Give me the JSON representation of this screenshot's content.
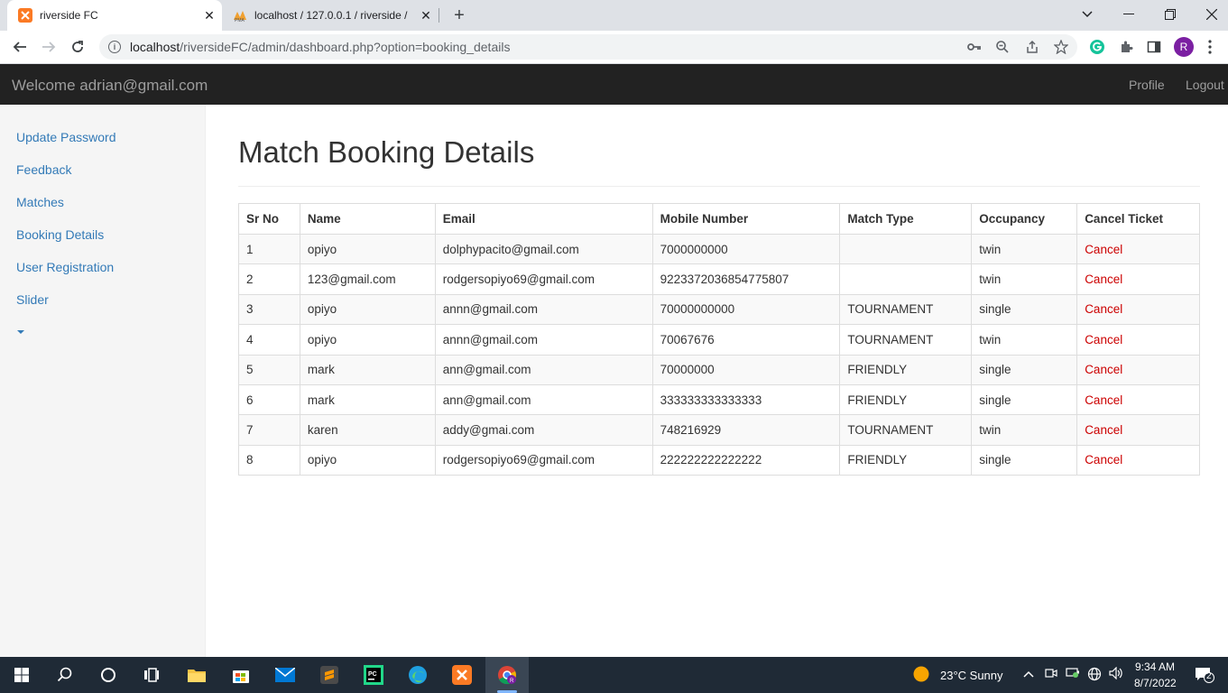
{
  "browser": {
    "tabs": [
      {
        "title": "riverside FC",
        "active": true
      },
      {
        "title": "localhost / 127.0.0.1 / riverside / ",
        "active": false
      }
    ],
    "url_host": "localhost",
    "url_path": "/riversideFC/admin/dashboard.php?option=booking_details",
    "profile_initial": "R"
  },
  "header": {
    "brand": "Welcome adrian@gmail.com",
    "links": [
      "Profile",
      "Logout"
    ]
  },
  "sidebar": {
    "items": [
      {
        "label": "Update Password"
      },
      {
        "label": "Feedback"
      },
      {
        "label": "Matches"
      },
      {
        "label": "Booking Details"
      },
      {
        "label": "User Registration"
      },
      {
        "label": "Slider"
      }
    ]
  },
  "main": {
    "title": "Match Booking Details",
    "table": {
      "headers": [
        "Sr No",
        "Name",
        "Email",
        "Mobile Number",
        "Match Type",
        "Occupancy",
        "Cancel Ticket"
      ],
      "rows": [
        [
          "1",
          "opiyo",
          "dolphypacito@gmail.com",
          "7000000000",
          "",
          "twin",
          "Cancel"
        ],
        [
          "2",
          "123@gmail.com",
          "rodgersopiyo69@gmail.com",
          "9223372036854775807",
          "",
          "twin",
          "Cancel"
        ],
        [
          "3",
          "opiyo",
          "annn@gmail.com",
          "70000000000",
          "TOURNAMENT",
          "single",
          "Cancel"
        ],
        [
          "4",
          "opiyo",
          "annn@gmail.com",
          "70067676",
          "TOURNAMENT",
          "twin",
          "Cancel"
        ],
        [
          "5",
          "mark",
          "ann@gmail.com",
          "70000000",
          "FRIENDLY",
          "single",
          "Cancel"
        ],
        [
          "6",
          "mark",
          "ann@gmail.com",
          "333333333333333",
          "FRIENDLY",
          "single",
          "Cancel"
        ],
        [
          "7",
          "karen",
          "addy@gmai.com",
          "748216929",
          "TOURNAMENT",
          "twin",
          "Cancel"
        ],
        [
          "8",
          "opiyo",
          "rodgersopiyo69@gmail.com",
          "222222222222222",
          "FRIENDLY",
          "single",
          "Cancel"
        ]
      ]
    }
  },
  "taskbar": {
    "weather": "23°C  Sunny",
    "time": "9:34 AM",
    "date": "8/7/2022",
    "notifications": "2"
  },
  "colors": {
    "navbar_bg": "#222222",
    "link": "#337ab7",
    "cancel": "#cc0000",
    "taskbar_bg": "#1f2a36"
  }
}
